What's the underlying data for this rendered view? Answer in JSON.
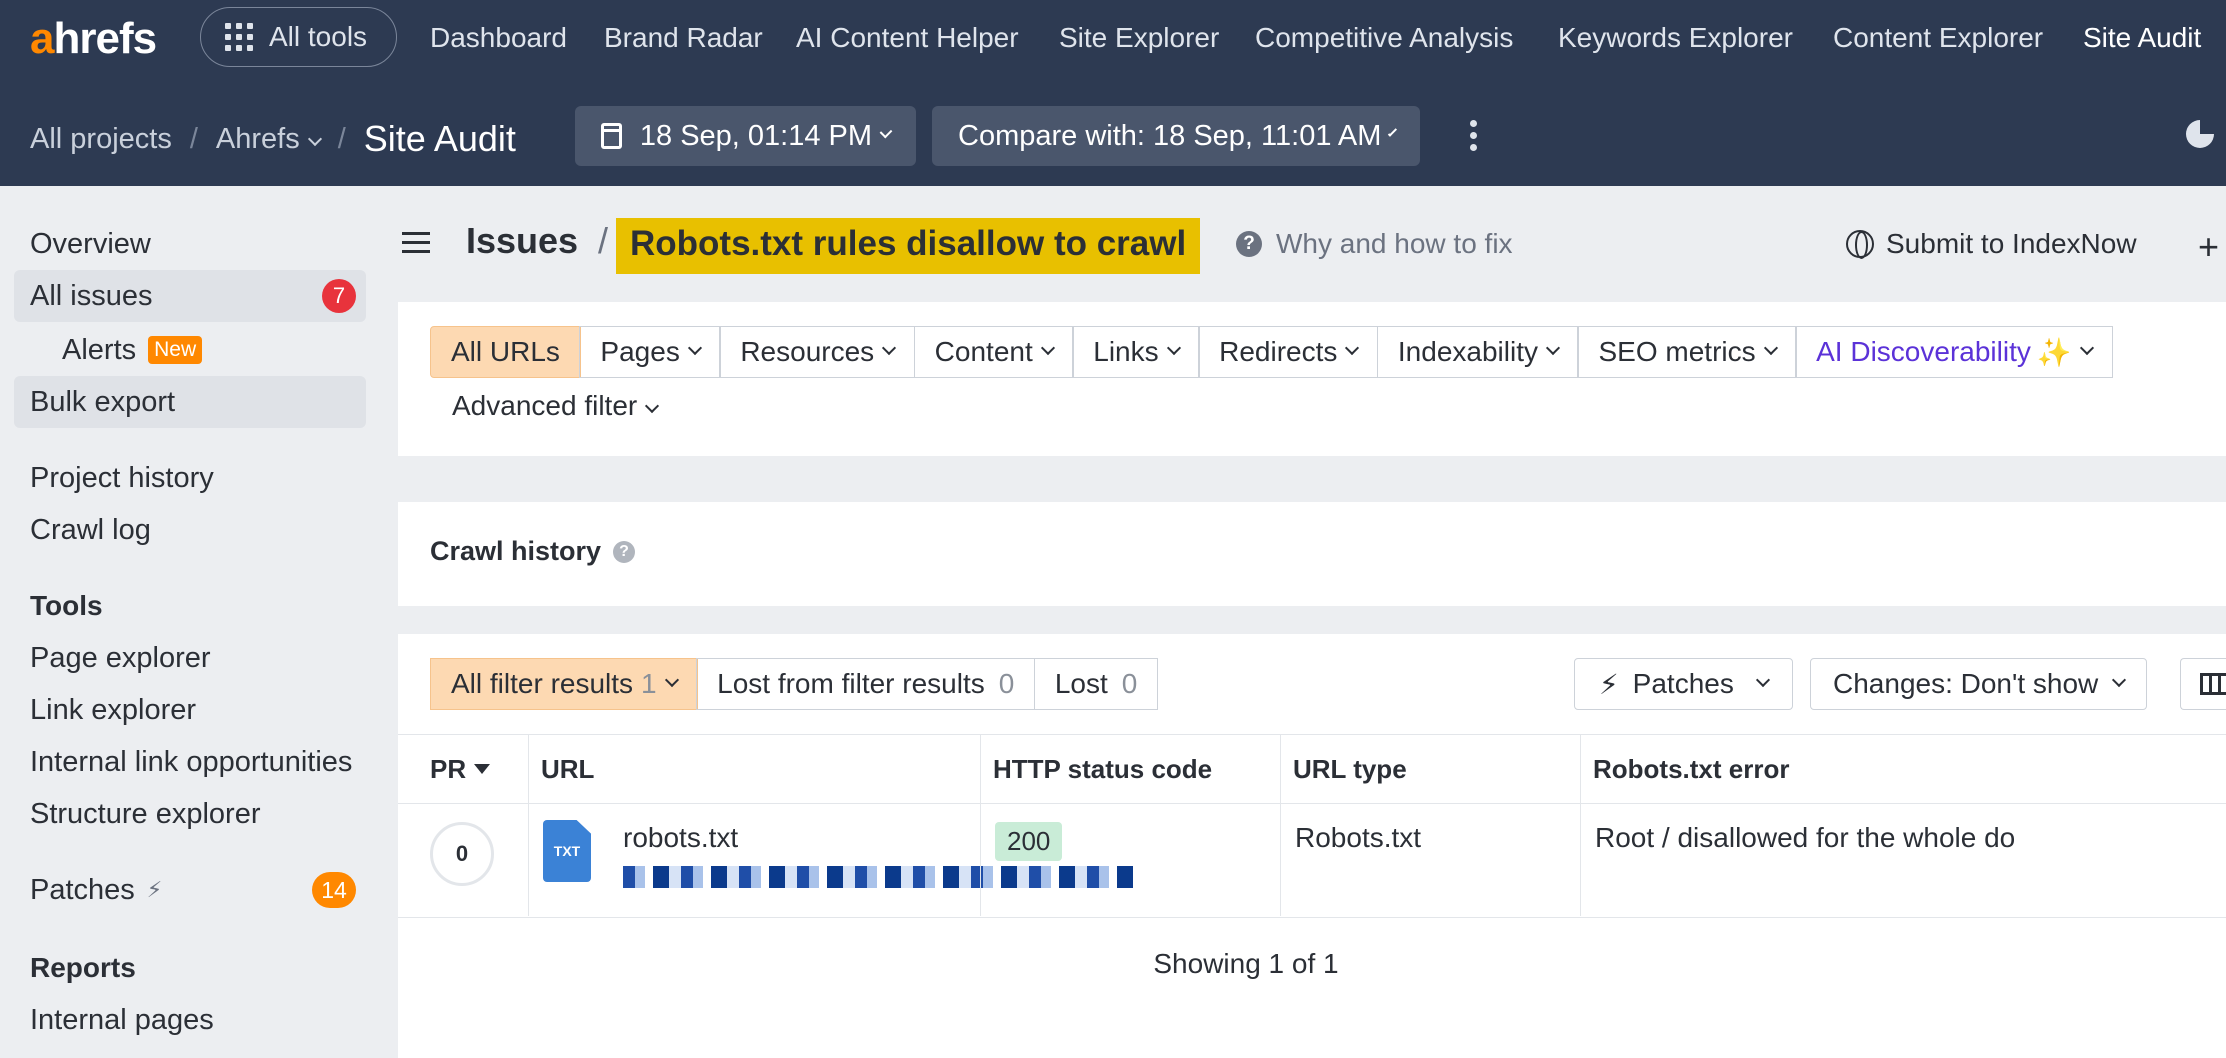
{
  "app": {
    "logo_prefix": "a",
    "logo_rest": "hrefs",
    "all_tools": "All tools",
    "nav": [
      "Dashboard",
      "Brand Radar",
      "AI Content Helper",
      "Site Explorer",
      "Competitive Analysis",
      "Keywords Explorer",
      "Content Explorer",
      "Site Audit"
    ]
  },
  "breadcrumb": {
    "all_projects": "All projects",
    "project": "Ahrefs",
    "current": "Site Audit"
  },
  "crawl_date": "18 Sep, 01:14 PM",
  "compare_with": "Compare with: 18 Sep, 11:01 AM",
  "sidebar": {
    "overview": "Overview",
    "all_issues": "All issues",
    "all_issues_count": "7",
    "alerts": "Alerts",
    "alerts_badge": "New",
    "bulk_export": "Bulk export",
    "project_history": "Project history",
    "crawl_log": "Crawl log",
    "tools_heading": "Tools",
    "page_explorer": "Page explorer",
    "link_explorer": "Link explorer",
    "internal_link_opportunities": "Internal link opportunities",
    "structure_explorer": "Structure explorer",
    "patches": "Patches",
    "patches_count": "14",
    "reports_heading": "Reports",
    "internal_pages": "Internal pages"
  },
  "header": {
    "section": "Issues",
    "separator": "/",
    "issue_title": "Robots.txt rules disallow to crawl",
    "why_fix": "Why and how to fix",
    "submit": "Submit to IndexNow",
    "plus": "+"
  },
  "filters": {
    "tabs": [
      "All URLs",
      "Pages",
      "Resources",
      "Content",
      "Links",
      "Redirects",
      "Indexability",
      "SEO metrics",
      "AI Discoverability"
    ],
    "ai_spark": "✨",
    "advanced": "Advanced filter"
  },
  "crawl_history": {
    "title": "Crawl history"
  },
  "results": {
    "all_filter": "All filter results",
    "all_filter_count": "1",
    "lost_from_filter": "Lost from filter results",
    "lost_from_filter_count": "0",
    "lost": "Lost",
    "lost_count": "0",
    "patches": "Patches",
    "changes": "Changes: Don't show"
  },
  "table": {
    "columns": [
      "PR",
      "URL",
      "HTTP status code",
      "URL type",
      "Robots.txt error"
    ],
    "rows": [
      {
        "pr": "0",
        "file_type": "TXT",
        "url_name": "robots.txt",
        "status": "200",
        "url_type": "Robots.txt",
        "robots_error": "Root / disallowed for the whole do"
      }
    ],
    "showing": "Showing 1 of 1"
  }
}
